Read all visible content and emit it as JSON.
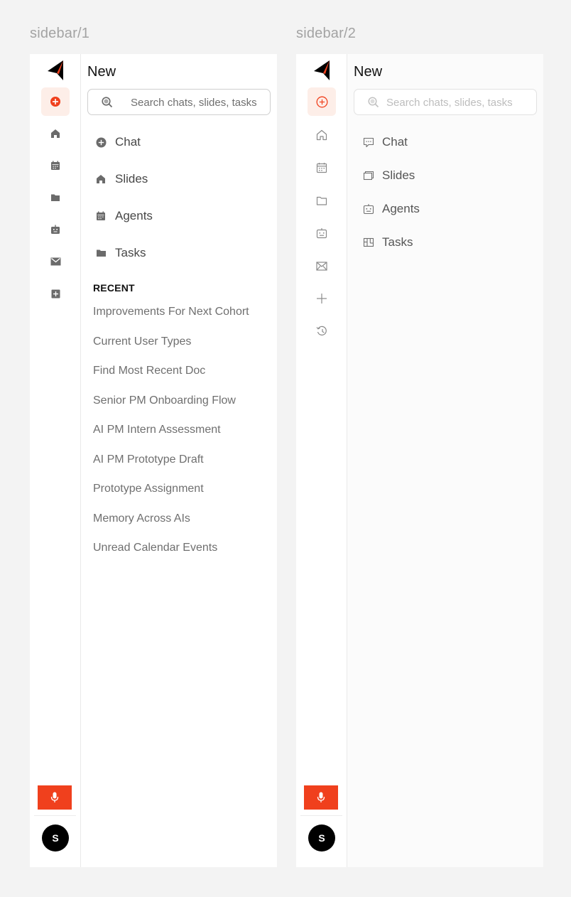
{
  "frames": [
    {
      "label": "sidebar/1",
      "panel": {
        "title": "New",
        "search_placeholder": "Search chats, slides, tasks",
        "nav": [
          {
            "label": "Chat",
            "icon": "plus-circle-icon"
          },
          {
            "label": "Slides",
            "icon": "home-icon"
          },
          {
            "label": "Agents",
            "icon": "calendar-icon"
          },
          {
            "label": "Tasks",
            "icon": "folder-icon"
          }
        ],
        "recent_heading": "RECENT",
        "recent": [
          "Improvements For Next Cohort",
          "Current User Types",
          "Find Most Recent Doc",
          "Senior PM Onboarding Flow",
          "AI PM Intern Assessment",
          "AI PM Prototype Draft",
          "Prototype Assignment",
          "Memory Across AIs",
          "Unread Calendar Events"
        ]
      },
      "rail": {
        "icons": [
          "new-chat-icon",
          "home-icon",
          "calendar-icon",
          "folder-icon",
          "robot-icon",
          "mail-icon",
          "add-square-icon"
        ],
        "avatar_initial": "S"
      }
    },
    {
      "label": "sidebar/2",
      "panel": {
        "title": "New",
        "search_placeholder": "Search chats, slides, tasks",
        "nav": [
          {
            "label": "Chat",
            "icon": "chat-bubble-icon"
          },
          {
            "label": "Slides",
            "icon": "slides-icon"
          },
          {
            "label": "Agents",
            "icon": "robot-icon"
          },
          {
            "label": "Tasks",
            "icon": "kanban-icon"
          }
        ]
      },
      "rail": {
        "icons": [
          "new-chat-icon",
          "home-icon",
          "calendar-icon",
          "folder-icon",
          "robot-icon",
          "mail-icon",
          "plus-icon",
          "history-icon"
        ],
        "avatar_initial": "S"
      }
    }
  ],
  "colors": {
    "accent": "#f0401d",
    "accent_soft": "#fdeee8",
    "avatar_bg": "#000000",
    "icon_solid": "#6b6b6b",
    "icon_outline": "#8a8a8a"
  }
}
